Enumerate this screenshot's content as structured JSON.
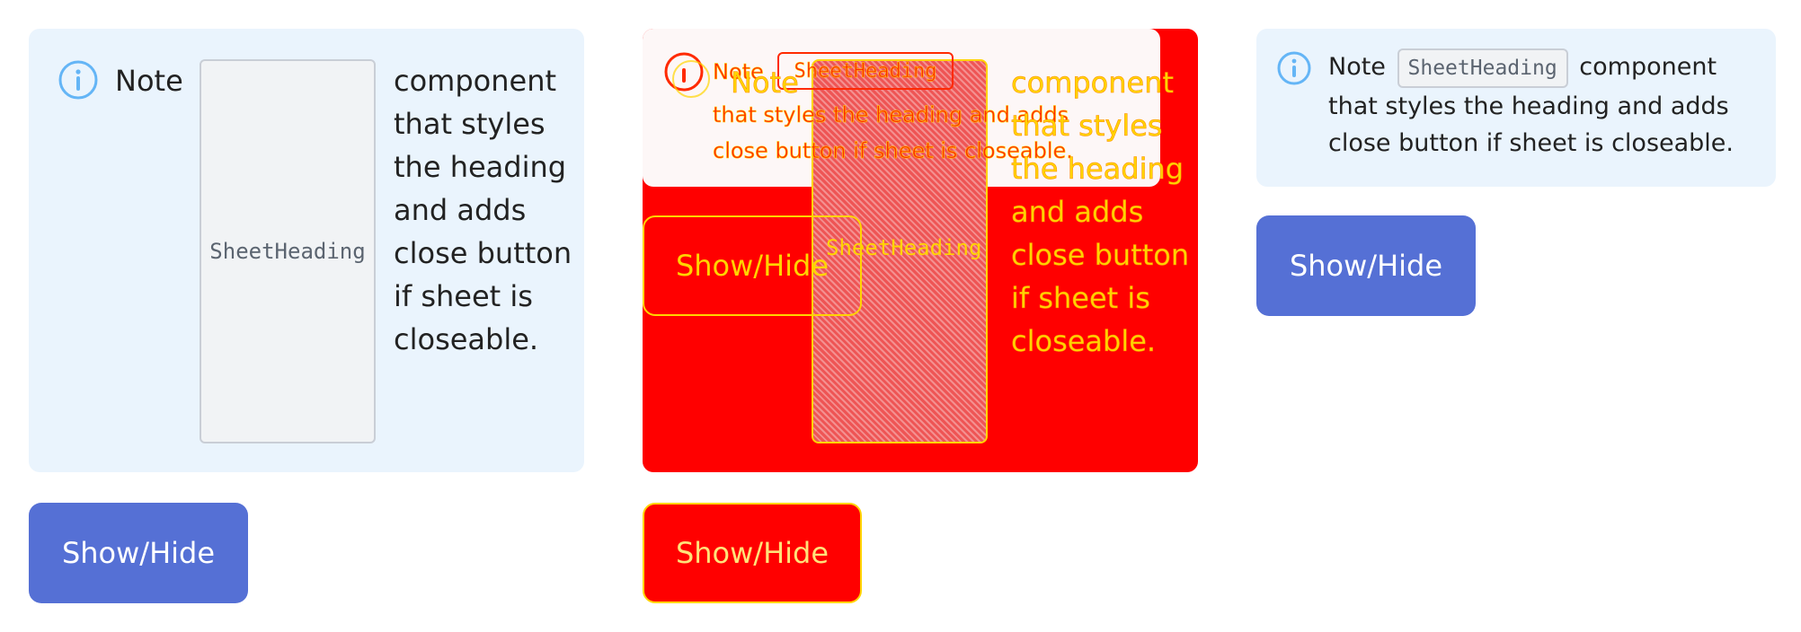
{
  "note": {
    "lead": "Note",
    "code": "SheetHeading",
    "rest": "component that styles the heading and adds close button if sheet is closeable.",
    "line2": "that styles the heading and adds",
    "line3": "close button if sheet is closeable."
  },
  "button": {
    "label": "Show/Hide"
  },
  "colors": {
    "note_bg": "#eaf4fd",
    "button_bg": "#5570d5",
    "icon": "#64b5f6",
    "diff_red": "#ff0000",
    "diff_yellow": "#ffd400"
  }
}
